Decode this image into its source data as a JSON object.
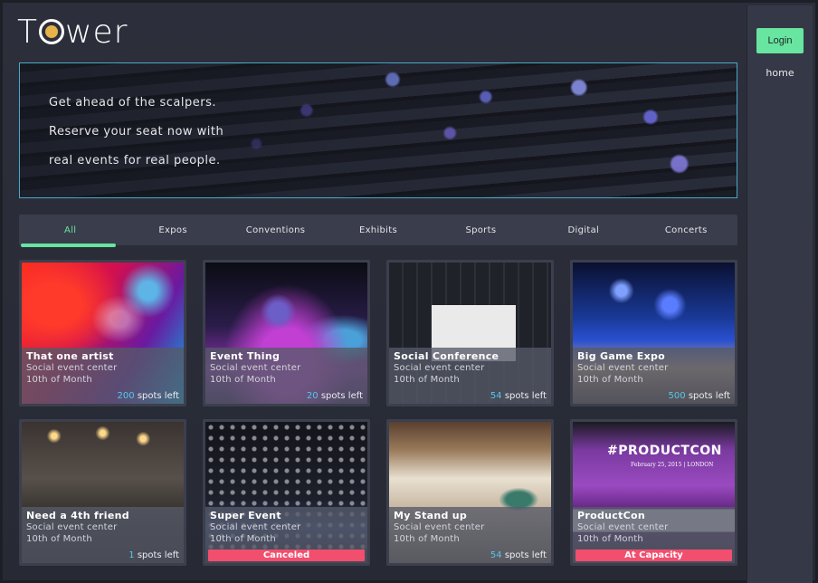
{
  "logo": {
    "text_left": "T",
    "text_right": "wer"
  },
  "sidebar": {
    "login_label": "Login",
    "home_label": "home"
  },
  "hero": {
    "lines": [
      "Get ahead of the scalpers.",
      "Reserve your seat now with",
      "real events for real people."
    ]
  },
  "tabs": [
    {
      "label": "All",
      "active": true
    },
    {
      "label": "Expos",
      "active": false
    },
    {
      "label": "Conventions",
      "active": false
    },
    {
      "label": "Exhibits",
      "active": false
    },
    {
      "label": "Sports",
      "active": false
    },
    {
      "label": "Digital",
      "active": false
    },
    {
      "label": "Concerts",
      "active": false
    }
  ],
  "colors": {
    "accent": "#67e5a1",
    "spots_number": "#56c7ec",
    "badge": "#f24e6e",
    "hero_border": "#4aa8c9"
  },
  "events": [
    {
      "title": "That one artist",
      "venue": "Social event center",
      "date": "10th of Month",
      "spots": "200",
      "spots_label": "spots left"
    },
    {
      "title": "Event Thing",
      "venue": "Social event center",
      "date": "10th of Month",
      "spots": "20",
      "spots_label": "spots left"
    },
    {
      "title": "Social Conference",
      "venue": "Social event center",
      "date": "10th of Month",
      "spots": "54",
      "spots_label": "spots left"
    },
    {
      "title": "Big Game Expo",
      "venue": "Social event center",
      "date": "10th of Month",
      "spots": "500",
      "spots_label": "spots left"
    },
    {
      "title": "Need a 4th friend",
      "venue": "Social event center",
      "date": "10th of Month",
      "spots": "1",
      "spots_label": "spots left"
    },
    {
      "title": "Super Event",
      "venue": "Social event center",
      "date": "10th of Month",
      "badge": "Canceled"
    },
    {
      "title": "My Stand up",
      "venue": "Social event center",
      "date": "10th of Month",
      "spots": "54",
      "spots_label": "spots left"
    },
    {
      "title": "ProductCon",
      "venue": "Social event center",
      "date": "10th of Month",
      "badge": "At Capacity",
      "image_text": "#PRODUCTCON",
      "image_subtext": "February 25, 2015 | LONDON"
    }
  ]
}
